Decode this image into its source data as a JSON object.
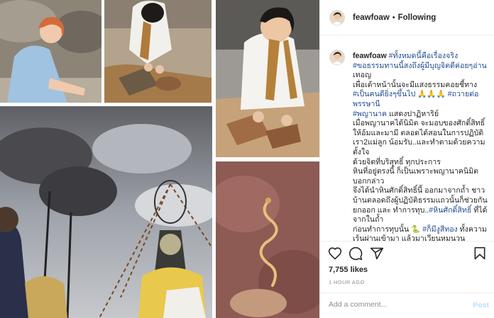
{
  "post": {
    "username": "feawfoaw",
    "separator": "•",
    "follow_status": "Following",
    "likes": "7,755 likes",
    "time_ago": "1 HOUR AGO",
    "comment_placeholder": "Add a comment...",
    "post_label": "Post"
  },
  "caption": {
    "username": "feawfoaw",
    "lines": [
      {
        "tag": "#ทั้งหมดนี้คือเรื่องจริง",
        "text": ""
      },
      {
        "tag": "#ขอธรรมทานนี้สงถึงผู้มีบุญจิตดีค่อยๆอ่าน",
        "text": ""
      },
      {
        "tag": "",
        "text": "เทอญ"
      },
      {
        "tag": "",
        "text": "เพื่อเต้าหน้านั้นจะมีแสงธรรมคอยชี้ทาง"
      },
      {
        "tag": "#เป็นคนดียิ่งๆขึ้นไป",
        "text": " 🙏🙏🙏 "
      },
      {
        "tag": "#ถวายต่อพรรษานี",
        "text": ""
      },
      {
        "tag": "#พญานาค",
        "text": " แสดงปาฏิหาริย์"
      },
      {
        "tag": "",
        "text": "เมื่อพญานาคได้นิมิต จะมอบของศักดิ์สิทธิ์ให้อ้มและมามี ตลอดได้สอนในการปฏิบัติ เรา2แม่ลูก น้อมรับ..และทำตามด้วยความตั้งใจ"
      },
      {
        "tag": "",
        "text": "ด้วยจิตที่บริสุทธิ์ ทุกประการ"
      },
      {
        "tag": "",
        "text": "หินที่อยู่ตรงนี้ ก็เป็นเพราะพญานาคนิมิตบอกกล่าว"
      },
      {
        "tag": "",
        "text": "จึงได้นำหินศักดิ์สิทธิ์นี้ ออกมาจากถ้ำ ชาวบ้านตลอดถึงผู้ปฏิบัติธรรมแถวนั้นก็ช่วยกันยกออก และ ทำการทุบ..",
        "tag2": "#หินศักดิ์สิทธิ์",
        "text2": " ที่ได้จากในถ้ำ"
      },
      {
        "tag": "",
        "text": "ก่อนทำการทุบนั้น 🐍 ",
        "tag2": "#ก็มีงูสีทอง",
        "text2": " ทั้งความเร้นผ่านเข้ามา แล้วมาเวียนหมุนวน"
      }
    ]
  },
  "icons": {
    "avatar": "avatar-image",
    "heart": "heart-icon",
    "comment": "comment-icon",
    "share": "share-icon",
    "save": "bookmark-icon"
  },
  "colors": {
    "hashtag": "#1e4b8f",
    "post_disabled": "#b2dffc",
    "muted": "#8e8e8e",
    "border": "#efefef"
  }
}
